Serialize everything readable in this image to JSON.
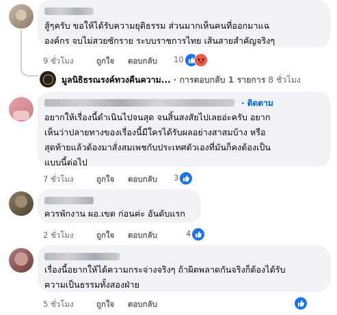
{
  "comments": [
    {
      "text_lines": [
        "สู้ๆครับ ขอให้ได้รับความยุติธรรม ส่วนมากเห็นคนที่ออกมาแฉ",
        "องค์กร จบไม่สวยซักราย ระบบราชการไทย เส้นสายสำคัญจริงๆ"
      ],
      "time": "9 ชั่วโมง",
      "like_label": "ถูกใจ",
      "reply_label": "ตอบกลับ",
      "reaction_count": "10",
      "reactions": [
        "like-icon",
        "angry-icon"
      ]
    },
    {
      "follow_label": "· ติดตาม",
      "text_lines": [
        "อยากให้เรื่องนี้ดำเนินไปจนสุด จนสิ้นสงสัยไปเลยอ่ะครับ อยาก",
        "เห็นว่าปลายทางของเรื่องนี้มีใครได้รับผลอย่างสาสมบ้าง หรือ",
        "สุดท้ายแล้วต้องมาสั่งสมเพชกับประเทศตัวเองที่มันก็คงต้องเป็น",
        "แบบนี้ต่อไป"
      ],
      "time": "7 ชั่วโมง",
      "like_label": "ถูกใจ",
      "reply_label": "ตอบกลับ",
      "reaction_count": "3",
      "reactions": [
        "like-icon"
      ]
    },
    {
      "text_lines": [
        "ควรพักงาน ผอ.เขต ก่อนค่ะ อันดับแรก"
      ],
      "time": "2 ชั่วโมง",
      "like_label": "ถูกใจ",
      "reply_label": "ตอบกลับ",
      "reaction_count": "4",
      "reactions": [
        "like-icon"
      ]
    },
    {
      "text_lines": [
        "เรื่องนี้อยากให้ได้ความกระจ่างจริงๆ ถ้าผิดพลาดกันจริงก็ต้องได้รับ",
        "ความเป็นธรรมทั้งสองฝ่าย"
      ],
      "time": "5 ชั่วโมง",
      "like_label": "ถูกใจ",
      "reply_label": "ตอบกลับ",
      "reaction_count": "",
      "reactions": [
        "like-icon"
      ]
    }
  ],
  "reply_preview": {
    "page_name": "มูลนิธิธรณรงค์ทวงคืนความ...",
    "text": "· การตอบกลับ 1 รายการ",
    "time": "8 ชั่วโมง"
  },
  "colors": {
    "accent": "#0064d1",
    "like": "#1b74e4",
    "angry": "#f0584c",
    "bubble": "#f0f2f5",
    "meta": "#65676b"
  }
}
